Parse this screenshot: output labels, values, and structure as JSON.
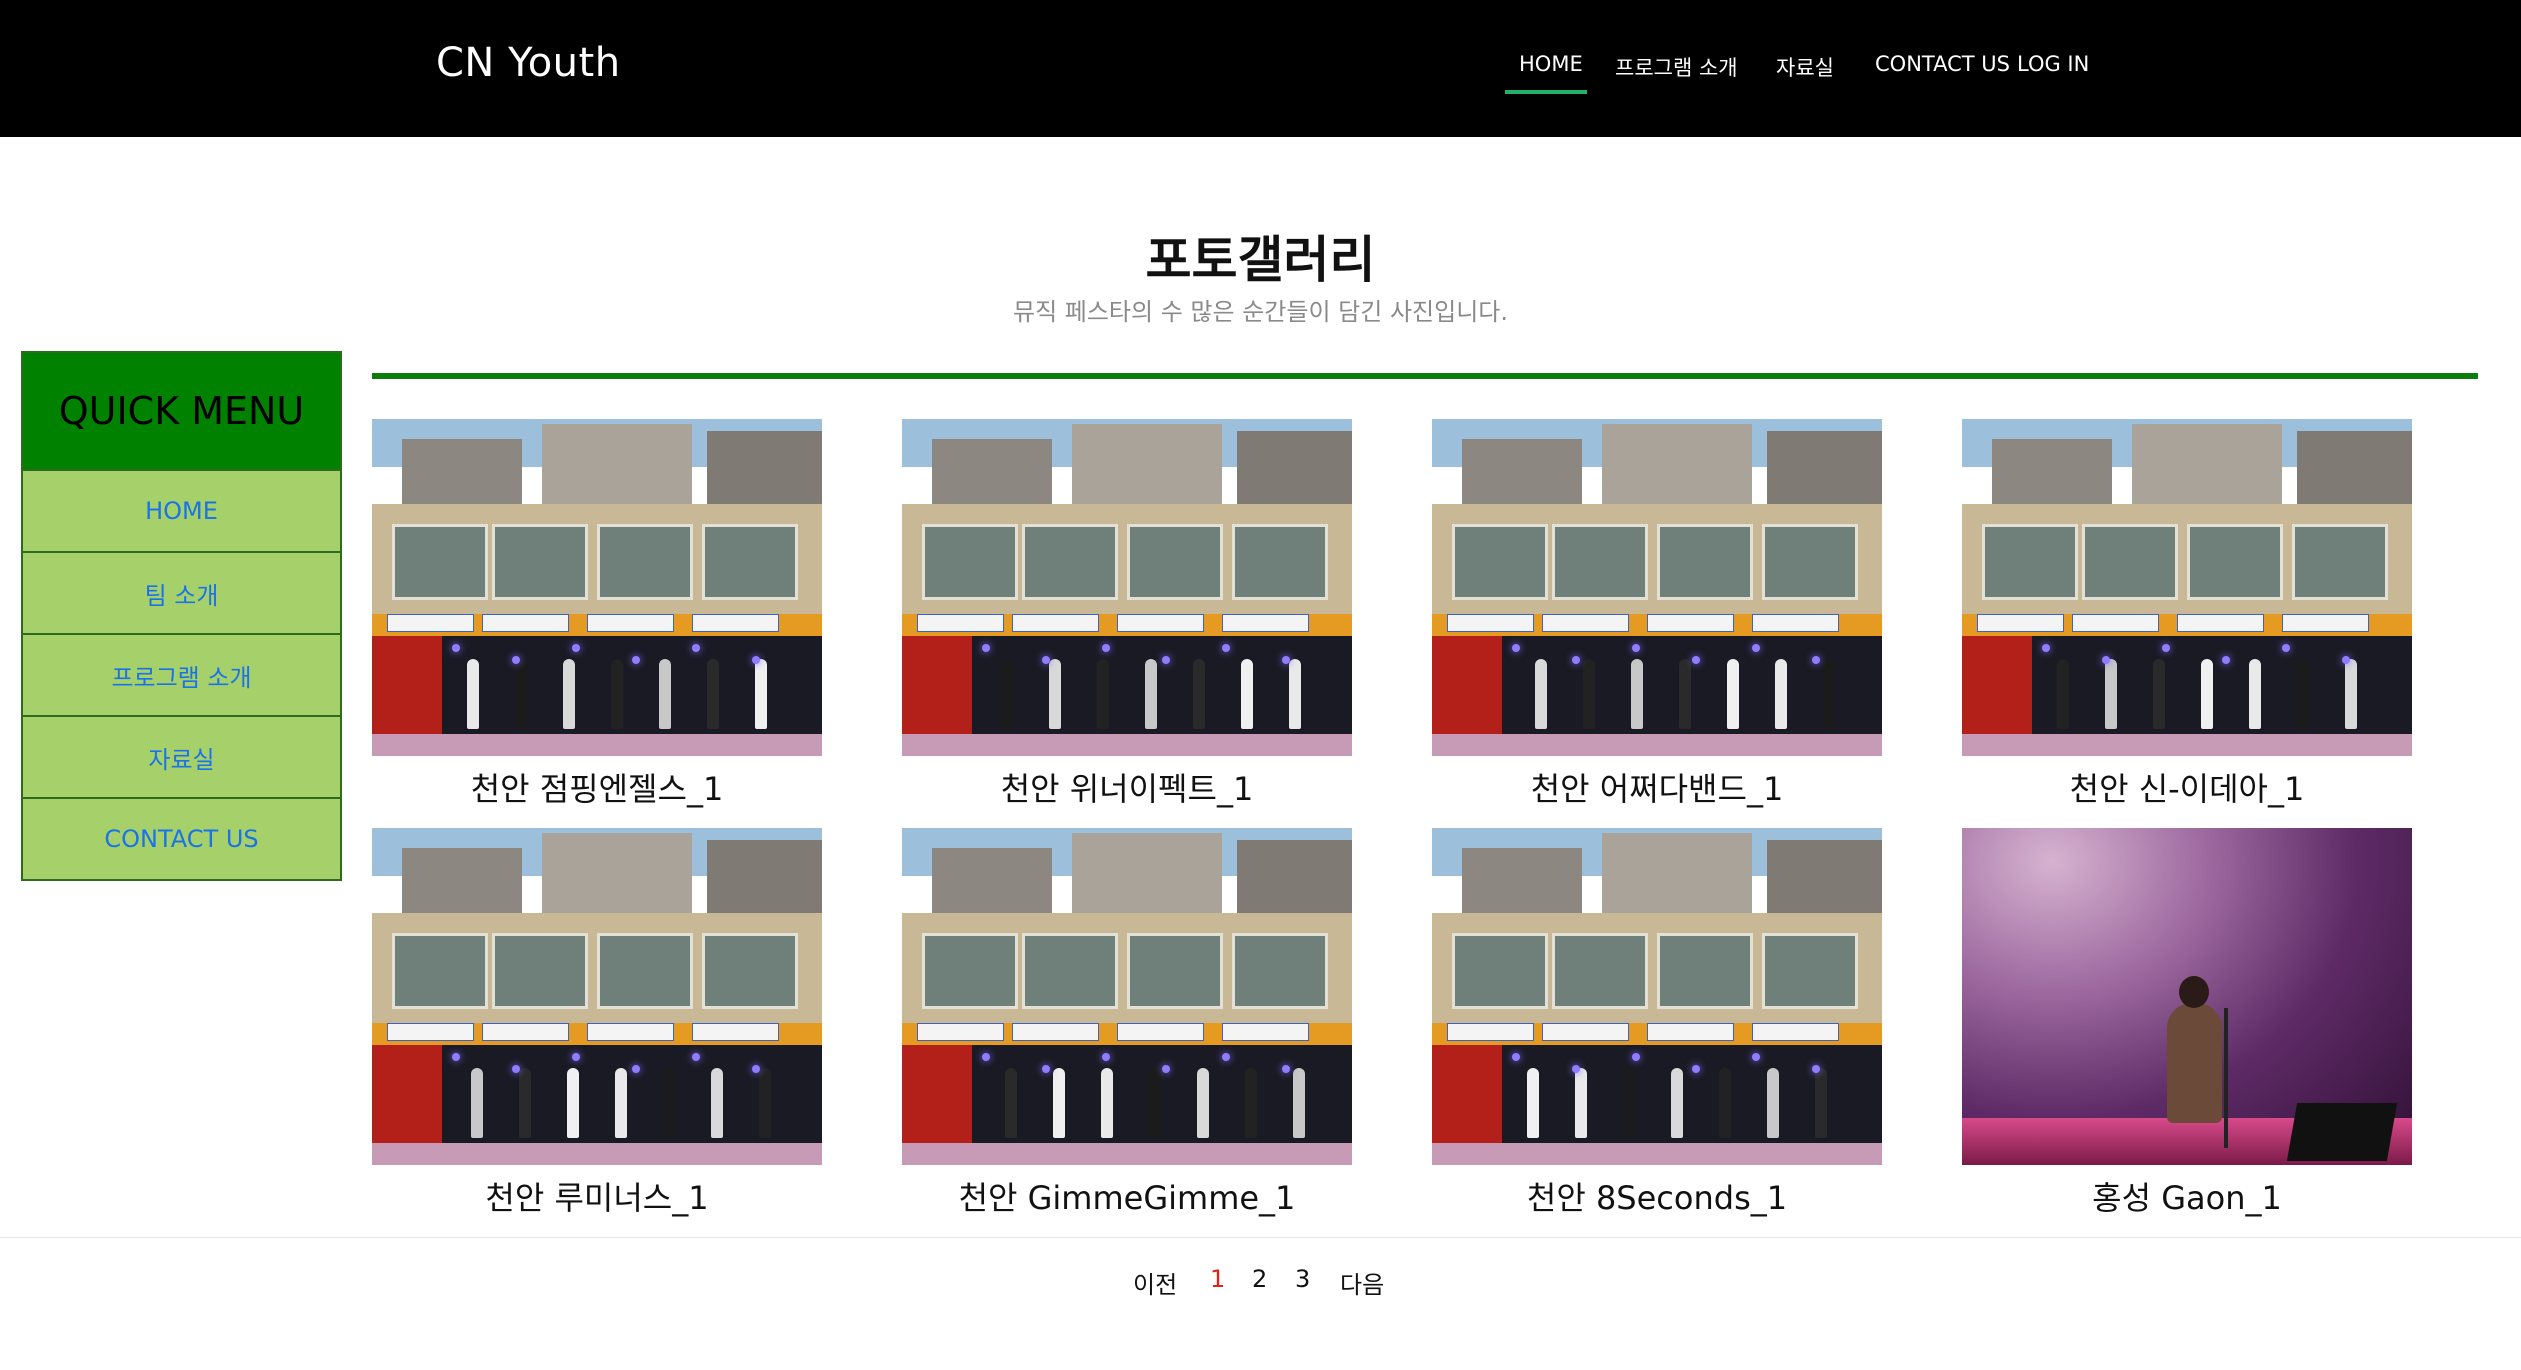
{
  "header": {
    "brand": "CN Youth",
    "nav": [
      {
        "label": "HOME",
        "active": true
      },
      {
        "label": "프로그램 소개"
      },
      {
        "label": "자료실"
      },
      {
        "label": "CONTACT US"
      },
      {
        "label": "LOG IN"
      }
    ],
    "active_underline_color": "#20b26b"
  },
  "page": {
    "title": "포토갤러리",
    "subtitle": "뮤직 페스타의 수 많은 순간들이 담긴 사진입니다."
  },
  "quick_menu": {
    "title": "QUICK MENU",
    "items": [
      "HOME",
      "팀 소개",
      "프로그램 소개",
      "자료실",
      "CONTACT US"
    ]
  },
  "gallery": [
    {
      "caption": "천안 점핑엔젤스_1",
      "icon": "stage-photo"
    },
    {
      "caption": "천안 위너이펙트_1",
      "icon": "stage-photo"
    },
    {
      "caption": "천안 어쩌다밴드_1",
      "icon": "stage-photo"
    },
    {
      "caption": "천안 신-이데아_1",
      "icon": "stage-photo"
    },
    {
      "caption": "천안 루미너스_1",
      "icon": "stage-photo"
    },
    {
      "caption": "천안 GimmeGimme_1",
      "icon": "stage-photo"
    },
    {
      "caption": "천안 8Seconds_1",
      "icon": "stage-photo"
    },
    {
      "caption": "홍성 Gaon_1",
      "icon": "concert-photo"
    }
  ],
  "pagination": {
    "prev": "이전",
    "pages": [
      "1",
      "2",
      "3"
    ],
    "current": "1",
    "next": "다음"
  },
  "colors": {
    "header_bg": "#000000",
    "rule": "#0a7e0a",
    "quick_menu_title_bg": "#008100",
    "quick_menu_bg": "#a6d16a",
    "link": "#1a73e8",
    "active_page": "#e0221b"
  }
}
